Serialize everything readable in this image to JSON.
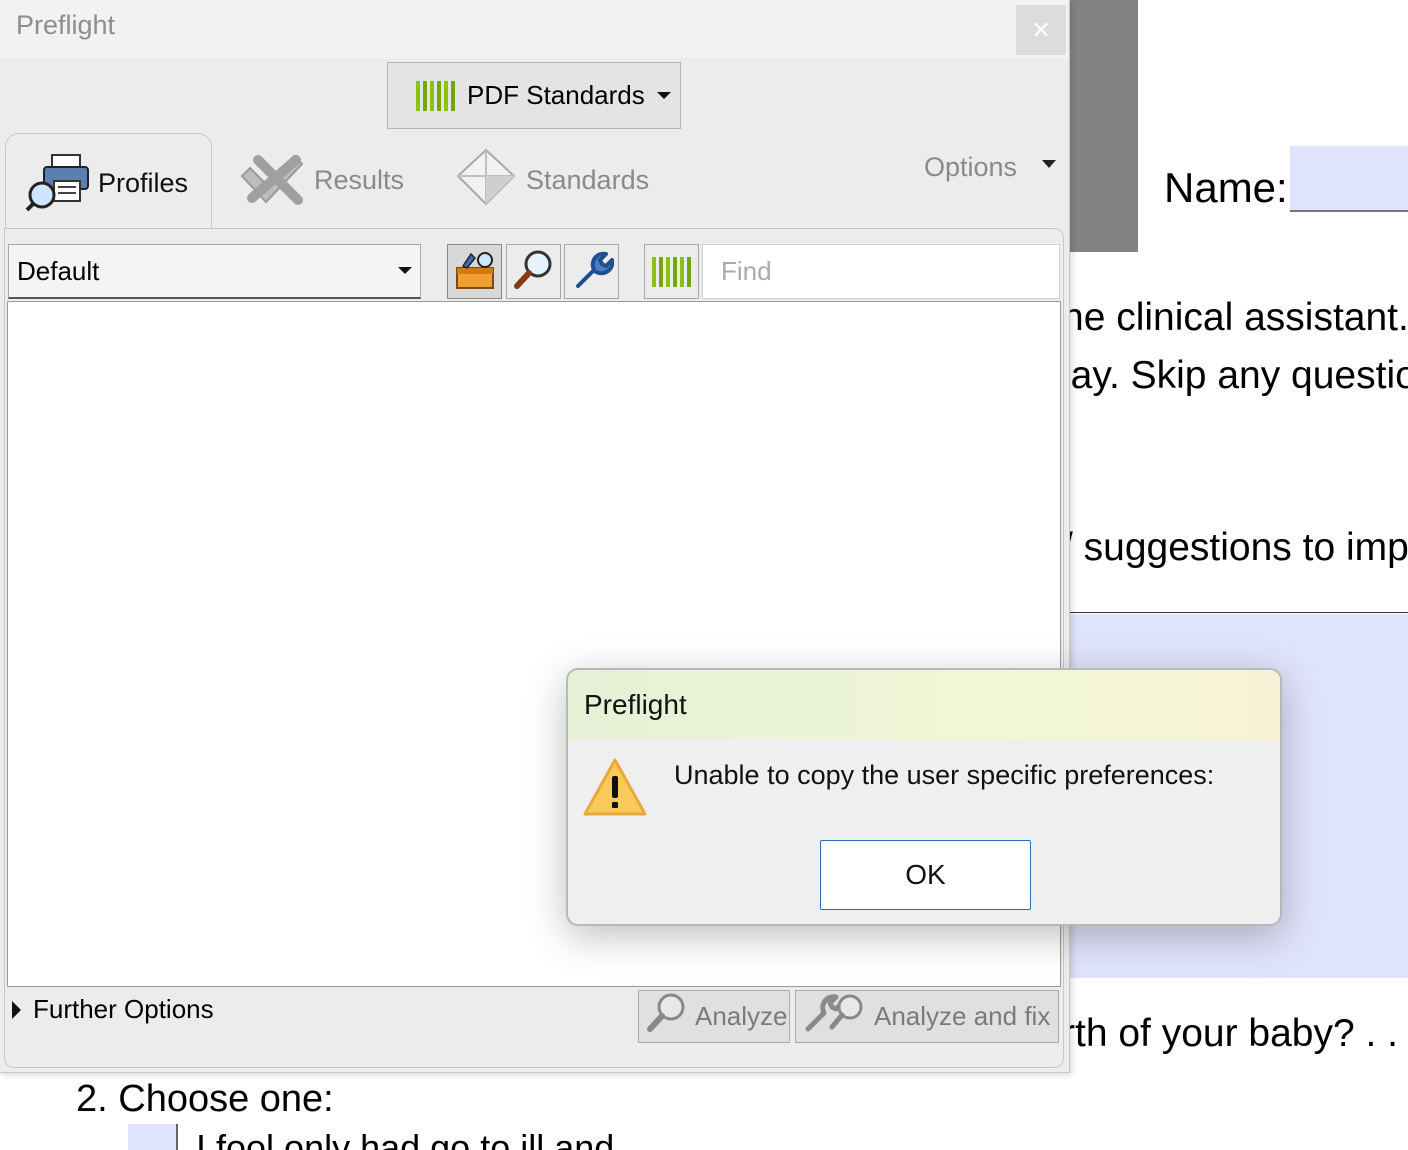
{
  "document": {
    "name_label": "Name:",
    "line1": "ne clinical assistant.",
    "line2": "lay. Skip any questio",
    "line3": "/ suggestions to imp",
    "line4": "rth of your baby?",
    "line4_dots": ". .",
    "question2": "2.  Choose one:",
    "clipped_text": "I fool only had go to ill and"
  },
  "panel": {
    "title": "Preflight",
    "close_glyph": "×",
    "standards_button": "PDF Standards",
    "tabs": [
      {
        "label": "Profiles",
        "active": true
      },
      {
        "label": "Results",
        "active": false
      },
      {
        "label": "Standards",
        "active": false
      }
    ],
    "options_label": "Options",
    "profile_select": "Default",
    "find_placeholder": "Find",
    "further_options": "Further Options",
    "analyze_button": "Analyze",
    "analyze_fix_button": "Analyze and fix",
    "toolbar_icons": [
      "toolbox-icon",
      "magnifier-icon",
      "wrench-icon",
      "pdf-standards-icon"
    ]
  },
  "dialog": {
    "title": "Preflight",
    "message": "Unable to copy the user specific preferences:",
    "ok_label": "OK",
    "icon": "warning-icon"
  },
  "colors": {
    "accent_green": "#8bc20f",
    "dialog_ok_border": "#2c6bb8",
    "form_field_blue": "#dfe3fb"
  }
}
